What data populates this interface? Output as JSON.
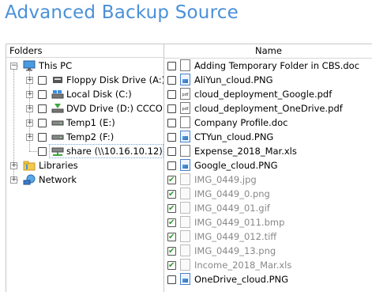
{
  "title": "Advanced Backup Source",
  "headers": {
    "folders": "Folders",
    "name": "Name"
  },
  "tree": {
    "this_pc": "This PC",
    "drives": [
      {
        "label": "Floppy Disk Drive (A:)",
        "icon": "floppy-drive-icon"
      },
      {
        "label": "Local Disk (C:)",
        "icon": "hard-disk-icon"
      },
      {
        "label": "DVD Drive (D:) CCCOM",
        "icon": "dvd-drive-icon"
      },
      {
        "label": "Temp1 (E:)",
        "icon": "disk-drive-icon"
      },
      {
        "label": "Temp2 (F:)",
        "icon": "disk-drive-icon"
      },
      {
        "label": "share (\\\\10.16.10.12) (",
        "icon": "network-drive-icon"
      }
    ],
    "libraries": "Libraries",
    "network": "Network"
  },
  "files": [
    {
      "name": "Adding Temporary Folder in CBS.doc",
      "type": "doc",
      "checked": false
    },
    {
      "name": "AliYun_cloud.PNG",
      "type": "png",
      "checked": false
    },
    {
      "name": "cloud_deployment_Google.pdf",
      "type": "pdf",
      "checked": false
    },
    {
      "name": "cloud_deployment_OneDrive.pdf",
      "type": "pdf",
      "checked": false
    },
    {
      "name": "Company Profile.doc",
      "type": "doc",
      "checked": false
    },
    {
      "name": "CTYun_cloud.PNG",
      "type": "png",
      "checked": false
    },
    {
      "name": "Expense_2018_Mar.xls",
      "type": "doc",
      "checked": false
    },
    {
      "name": "Google_cloud.PNG",
      "type": "png",
      "checked": false
    },
    {
      "name": "IMG_0449.jpg",
      "type": "dim",
      "checked": true
    },
    {
      "name": "IMG_0449_0.png",
      "type": "dim",
      "checked": true
    },
    {
      "name": "IMG_0449_01.gif",
      "type": "dim",
      "checked": true
    },
    {
      "name": "IMG_0449_011.bmp",
      "type": "dim",
      "checked": true
    },
    {
      "name": "IMG_0449_012.tiff",
      "type": "dim",
      "checked": true
    },
    {
      "name": "IMG_0449_13.png",
      "type": "dim",
      "checked": true
    },
    {
      "name": "Income_2018_Mar.xls",
      "type": "dim",
      "checked": true
    },
    {
      "name": "OneDrive_cloud.PNG",
      "type": "png",
      "checked": false
    }
  ],
  "colors": {
    "title": "#4a90d9",
    "check": "#2e9a2e",
    "dimmed_text": "#888888"
  }
}
